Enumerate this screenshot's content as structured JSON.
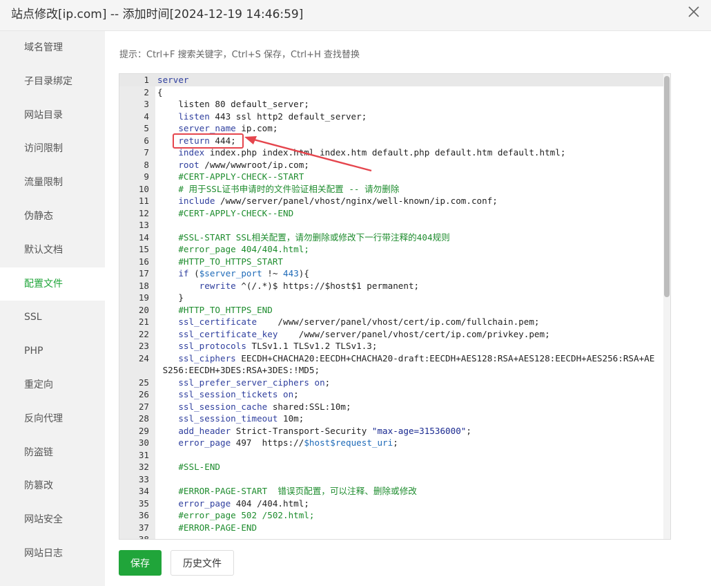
{
  "window": {
    "title": "站点修改[ip.com] -- 添加时间[2024-12-19 14:46:59]",
    "close_icon": "close-icon"
  },
  "sidebar": {
    "items": [
      {
        "label": "域名管理",
        "active": false
      },
      {
        "label": "子目录绑定",
        "active": false
      },
      {
        "label": "网站目录",
        "active": false
      },
      {
        "label": "访问限制",
        "active": false
      },
      {
        "label": "流量限制",
        "active": false
      },
      {
        "label": "伪静态",
        "active": false
      },
      {
        "label": "默认文档",
        "active": false
      },
      {
        "label": "配置文件",
        "active": true
      },
      {
        "label": "SSL",
        "active": false
      },
      {
        "label": "PHP",
        "active": false
      },
      {
        "label": "重定向",
        "active": false
      },
      {
        "label": "反向代理",
        "active": false
      },
      {
        "label": "防盗链",
        "active": false
      },
      {
        "label": "防篡改",
        "active": false
      },
      {
        "label": "网站安全",
        "active": false
      },
      {
        "label": "网站日志",
        "active": false
      }
    ]
  },
  "hint": "提示：Ctrl+F 搜索关键字，Ctrl+S 保存，Ctrl+H 查找替换",
  "editor": {
    "lines": [
      {
        "n": "1",
        "text": "server",
        "kind": "kw"
      },
      {
        "n": "2",
        "text": "{",
        "kind": ""
      },
      {
        "n": "3",
        "text": "    listen 80 default_server;",
        "kind": ""
      },
      {
        "n": "4",
        "text": "    listen 443 ssl http2 default_server;",
        "kind": "kwprefix:listen"
      },
      {
        "n": "5",
        "text": "    server_name ip.com;",
        "kind": "kwprefix:server_name"
      },
      {
        "n": "6",
        "text": "    return 444;",
        "kind": "kwprefix:return"
      },
      {
        "n": "7",
        "text": "    index index.php index.html index.htm default.php default.htm default.html;",
        "kind": "kwprefix:index"
      },
      {
        "n": "8",
        "text": "    root /www/wwwroot/ip.com;",
        "kind": "kwprefix:root"
      },
      {
        "n": "9",
        "text": "    #CERT-APPLY-CHECK--START",
        "kind": "cm"
      },
      {
        "n": "10",
        "text": "    # 用于SSL证书申请时的文件验证相关配置 -- 请勿删除",
        "kind": "cm"
      },
      {
        "n": "11",
        "text": "    include /www/server/panel/vhost/nginx/well-known/ip.com.conf;",
        "kind": "kwprefix:include"
      },
      {
        "n": "12",
        "text": "    #CERT-APPLY-CHECK--END",
        "kind": "cm"
      },
      {
        "n": "13",
        "text": "",
        "kind": ""
      },
      {
        "n": "14",
        "text": "    #SSL-START SSL相关配置，请勿删除或修改下一行带注释的404规则",
        "kind": "cm"
      },
      {
        "n": "15",
        "text": "    #error_page 404/404.html;",
        "kind": "cm"
      },
      {
        "n": "16",
        "text": "    #HTTP_TO_HTTPS_START",
        "kind": "cm"
      },
      {
        "n": "17",
        "text": "    if ($server_port !~ 443){",
        "kind": "if"
      },
      {
        "n": "18",
        "text": "        rewrite ^(/.*)$ https://$host$1 permanent;",
        "kind": "kwprefix:rewrite"
      },
      {
        "n": "19",
        "text": "    }",
        "kind": ""
      },
      {
        "n": "20",
        "text": "    #HTTP_TO_HTTPS_END",
        "kind": "cm"
      },
      {
        "n": "21",
        "text": "    ssl_certificate    /www/server/panel/vhost/cert/ip.com/fullchain.pem;",
        "kind": "kwprefix:ssl_certificate"
      },
      {
        "n": "22",
        "text": "    ssl_certificate_key    /www/server/panel/vhost/cert/ip.com/privkey.pem;",
        "kind": "kwprefix:ssl_certificate_key"
      },
      {
        "n": "23",
        "text": "    ssl_protocols TLSv1.1 TLSv1.2 TLSv1.3;",
        "kind": "kwprefix:ssl_protocols"
      },
      {
        "n": "24",
        "text": "    ssl_ciphers EECDH+CHACHA20:EECDH+CHACHA20-draft:EECDH+AES128:RSA+AES128:EECDH+AES256:RSA+AES256:EECDH+3DES:RSA+3DES:!MD5;",
        "kind": "kwprefix:ssl_ciphers"
      },
      {
        "n": "25",
        "text": "    ssl_prefer_server_ciphers on;",
        "kind": "kwon:ssl_prefer_server_ciphers"
      },
      {
        "n": "26",
        "text": "    ssl_session_tickets on;",
        "kind": "kwon:ssl_session_tickets"
      },
      {
        "n": "27",
        "text": "    ssl_session_cache shared:SSL:10m;",
        "kind": "kwprefix:ssl_session_cache"
      },
      {
        "n": "28",
        "text": "    ssl_session_timeout 10m;",
        "kind": "kwprefix:ssl_session_timeout"
      },
      {
        "n": "29",
        "text": "    add_header Strict-Transport-Security \"max-age=31536000\";",
        "kind": "addheader"
      },
      {
        "n": "30",
        "text": "    error_page 497  https://$host$request_uri;",
        "kind": "errorpage497"
      },
      {
        "n": "31",
        "text": "",
        "kind": ""
      },
      {
        "n": "32",
        "text": "    #SSL-END",
        "kind": "cm"
      },
      {
        "n": "33",
        "text": "",
        "kind": ""
      },
      {
        "n": "34",
        "text": "    #ERROR-PAGE-START  错误页配置，可以注释、删除或修改",
        "kind": "cm"
      },
      {
        "n": "35",
        "text": "    error_page 404 /404.html;",
        "kind": "kwprefix:error_page"
      },
      {
        "n": "36",
        "text": "    #error_page 502 /502.html;",
        "kind": "cm"
      },
      {
        "n": "37",
        "text": "    #ERROR-PAGE-END",
        "kind": "cm"
      },
      {
        "n": "38",
        "text": "",
        "kind": ""
      }
    ],
    "active_line": 1,
    "highlighted_line": 6
  },
  "buttons": {
    "save": "保存",
    "history": "历史文件"
  },
  "colors": {
    "accent": "#20a53a",
    "annotation": "#e5454d",
    "keyword": "#2f3f9e",
    "comment": "#1e8c2e"
  }
}
